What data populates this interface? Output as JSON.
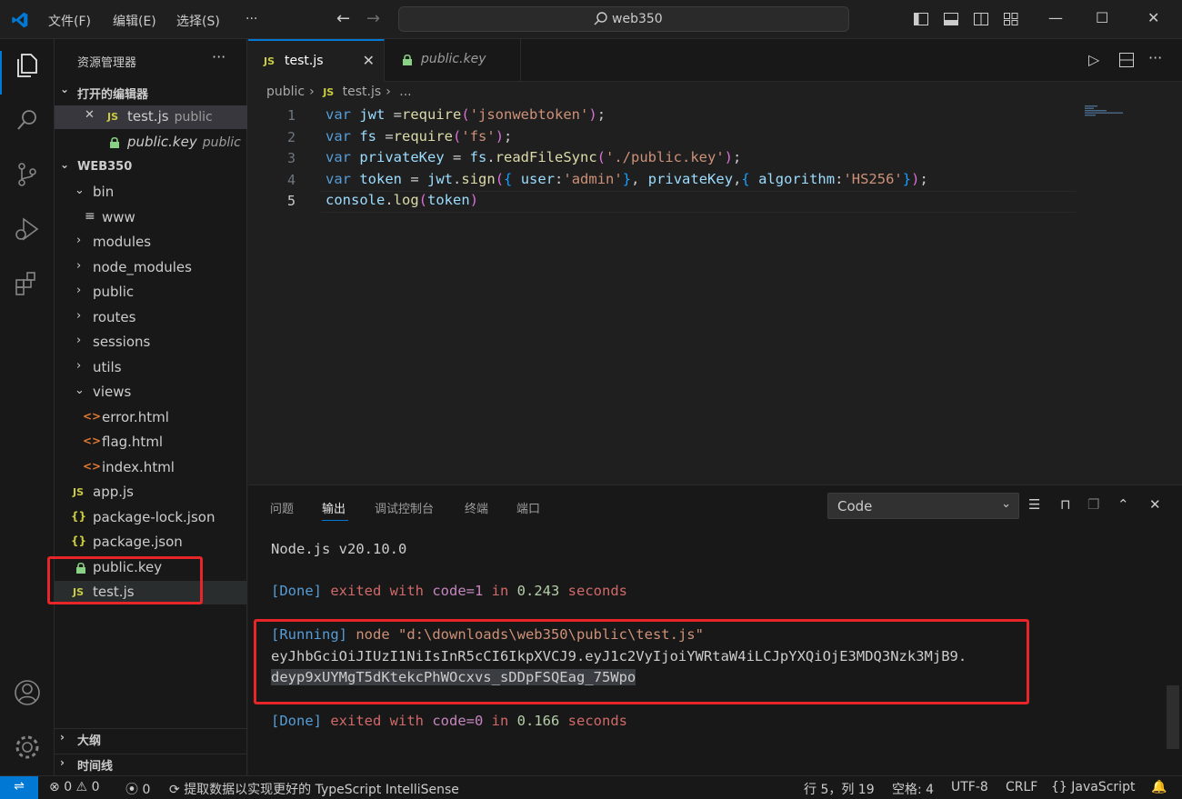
{
  "app": {
    "menu": [
      "文件(F)",
      "编辑(E)",
      "选择(S)",
      "···"
    ],
    "search_text": "web350"
  },
  "sidebar": {
    "title": "资源管理器",
    "open_editors_header": "打开的编辑器",
    "open_editors": [
      {
        "name": "test.js",
        "desc": "public"
      },
      {
        "name": "public.key",
        "desc": "public"
      }
    ],
    "project_header": "WEB350",
    "tree": {
      "bin": "bin",
      "www": "www",
      "modules": "modules",
      "node_modules": "node_modules",
      "public": "public",
      "routes": "routes",
      "sessions": "sessions",
      "utils": "utils",
      "views": "views",
      "error": "error.html",
      "flag": "flag.html",
      "index": "index.html",
      "app": "app.js",
      "package_lock": "package-lock.json",
      "package": "package.json",
      "public_key": "public.key",
      "test": "test.js"
    },
    "outline_header": "大纲",
    "timeline_header": "时间线"
  },
  "tabs": [
    {
      "label": "test.js"
    },
    {
      "label": "public.key"
    }
  ],
  "breadcrumb": [
    "public",
    "test.js",
    "..."
  ],
  "editor": {
    "line_numbers": [
      "1",
      "2",
      "3",
      "4",
      "5"
    ]
  },
  "panel": {
    "tabs": [
      "问题",
      "输出",
      "调试控制台",
      "终端",
      "端口"
    ],
    "channel": "Code",
    "output": {
      "line1": "Node.js v20.10.0",
      "done1_tag": "[Done]",
      "done1_mid": " exited with ",
      "done1_code": "code=1",
      "done1_in": " in ",
      "done1_time": "0.243",
      "done1_sec": " seconds",
      "run_tag": "[Running]",
      "run_cmd": " node \"d:\\downloads\\web350\\public\\test.js\"",
      "token_line1": "eyJhbGciOiJIUzI1NiIsInR5cCI6IkpXVCJ9.eyJ1c2VyIjoiYWRtaW4iLCJpYXQiOjE3MDQ3Nzk3MjB9.",
      "token_line2": "deyp9xUYMgT5dKtekcPhWOcxvs_sDDpFSQEag_75Wpo",
      "done2_tag": "[Done]",
      "done2_mid": " exited with ",
      "done2_code": "code=0",
      "done2_in": " in ",
      "done2_time": "0.166",
      "done2_sec": " seconds"
    }
  },
  "status": {
    "errors": "0",
    "warnings": "0",
    "ports": "0",
    "message": "提取数据以实现更好的 TypeScript IntelliSense",
    "position": "行 5，列 19",
    "spaces": "空格: 4",
    "encoding": "UTF-8",
    "eol": "CRLF",
    "language": "JavaScript"
  },
  "colors": {
    "accent": "#0078d4",
    "annotation": "#e8262a"
  }
}
